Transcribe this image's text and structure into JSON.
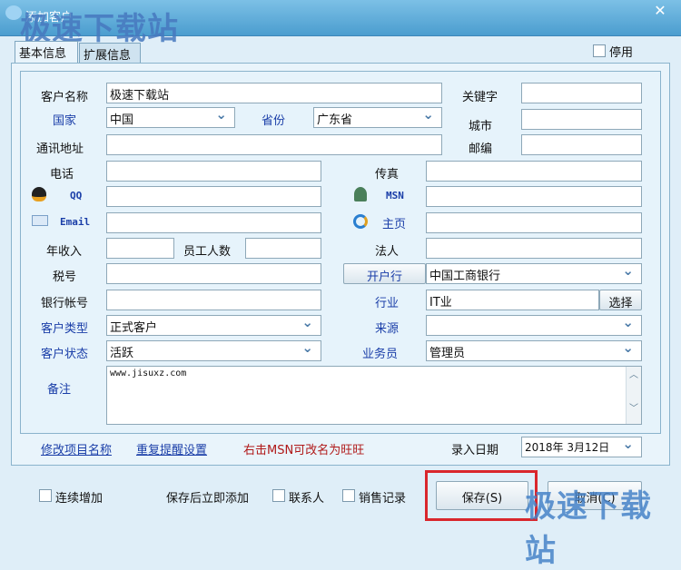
{
  "window": {
    "title": "添加客户",
    "close_icon": "close-icon"
  },
  "watermark": "极速下载站",
  "tabs": [
    {
      "label": "基本信息",
      "active": true
    },
    {
      "label": "扩展信息",
      "active": false
    }
  ],
  "disabled_checkbox": {
    "label": "停用",
    "checked": false
  },
  "fields": {
    "customer_name": {
      "label": "客户名称",
      "value": "极速下载站"
    },
    "keyword": {
      "label": "关键字",
      "value": ""
    },
    "country": {
      "label": "国家",
      "value": "中国"
    },
    "province": {
      "label": "省份",
      "value": "广东省"
    },
    "city": {
      "label": "城市",
      "value": ""
    },
    "address": {
      "label": "通讯地址",
      "value": ""
    },
    "postcode": {
      "label": "邮编",
      "value": ""
    },
    "phone": {
      "label": "电话",
      "value": ""
    },
    "fax": {
      "label": "传真",
      "value": ""
    },
    "qq": {
      "label": "QQ",
      "value": ""
    },
    "msn": {
      "label": "MSN",
      "value": ""
    },
    "email": {
      "label": "Email",
      "value": ""
    },
    "homepage": {
      "label": "主页",
      "value": ""
    },
    "revenue": {
      "label": "年收入",
      "value": ""
    },
    "employees": {
      "label": "员工人数",
      "value": ""
    },
    "legal_person": {
      "label": "法人",
      "value": ""
    },
    "tax_id": {
      "label": "税号",
      "value": ""
    },
    "bank": {
      "label": "开户行",
      "value": "中国工商银行"
    },
    "bank_account": {
      "label": "银行帐号",
      "value": ""
    },
    "industry": {
      "label": "行业",
      "value": "IT业",
      "button": "选择"
    },
    "customer_type": {
      "label": "客户类型",
      "value": "正式客户"
    },
    "source": {
      "label": "来源",
      "value": ""
    },
    "customer_status": {
      "label": "客户状态",
      "value": "活跃"
    },
    "salesperson": {
      "label": "业务员",
      "value": "管理员"
    },
    "remark": {
      "label": "备注",
      "value": "www.jisuxz.com"
    }
  },
  "links": {
    "rename": "修改项目名称",
    "reminder": "重复提醒设置",
    "hint": "右击MSN可改名为旺旺"
  },
  "entry_date": {
    "label": "录入日期",
    "value": "2018年 3月12日"
  },
  "footer": {
    "continuous": "连续增加",
    "after_save": "保存后立即添加",
    "contacts": "联系人",
    "sales": "销售记录",
    "save": "保存(S)",
    "cancel": "取消(C)"
  },
  "colors": {
    "titlebar": "#4b9dcf",
    "label_blue": "#1a3ea8",
    "hint_red": "#b01818",
    "highlight": "#d9262c"
  }
}
